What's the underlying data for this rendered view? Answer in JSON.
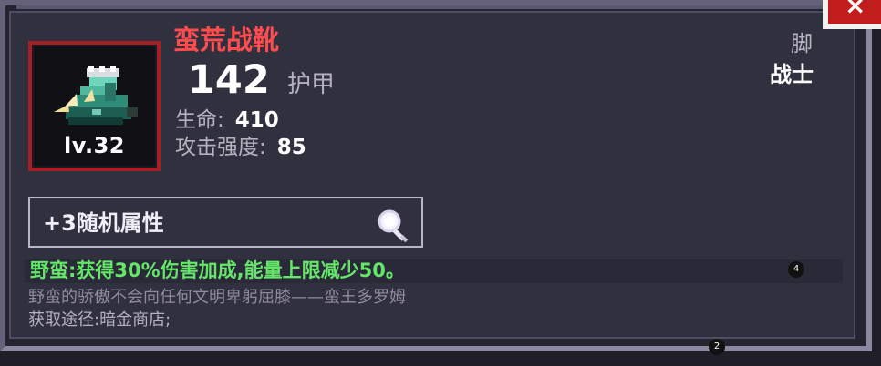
{
  "item": {
    "name": "蛮荒战靴",
    "level": "lv.32",
    "armor_value": "142",
    "armor_label": "护甲",
    "slot_type": "脚",
    "class_name": "战士",
    "stats": [
      {
        "label": "生命:",
        "value": "410"
      },
      {
        "label": "攻击强度:",
        "value": "85"
      }
    ]
  },
  "random_attributes": {
    "label": "+3随机属性",
    "icon": "magnifier-icon"
  },
  "effect": {
    "text": "野蛮:获得30%伤害加成,能量上限减少50。"
  },
  "flavor": {
    "text": "野蛮的骄傲不会向任何文明卑躬屈膝——蛮王多罗姆"
  },
  "source": {
    "text": "获取途径:暗金商店;"
  },
  "badges": {
    "effect_badge": "4",
    "bottom_badge": "2"
  },
  "colors": {
    "item_name": "#ff4d4f",
    "effect_text": "#65e56a",
    "frame_border": "#a61f24",
    "panel_background": "#30303f"
  },
  "controls": {
    "close_icon": "close-icon"
  }
}
